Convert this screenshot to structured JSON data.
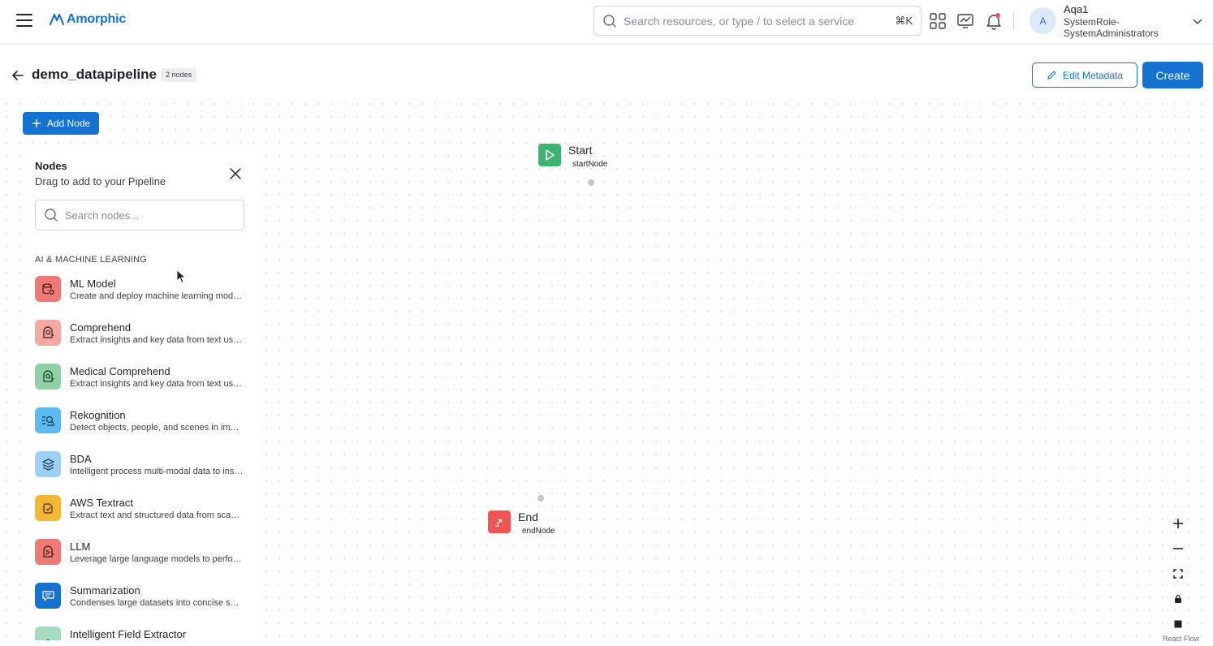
{
  "app": {
    "brand": "Amorphic",
    "brand_color": "#1a73c9",
    "primary_color": "#1572d0"
  },
  "header": {
    "search": {
      "placeholder": "Search resources, or type / to select a service",
      "shortcut": "⌘K"
    },
    "icons": [
      "apps-grid-icon",
      "monitor-chart-icon",
      "bell-icon"
    ],
    "user": {
      "initial": "A",
      "name": "Aqa1",
      "role": "SystemRole-SystemAdministrators"
    }
  },
  "page": {
    "title": "demo_datapipeline",
    "node_count_badge": "2 nodes",
    "edit_metadata_label": "Edit Metadata",
    "create_label": "Create"
  },
  "toolbar": {
    "add_node_label": "Add Node"
  },
  "panel": {
    "title": "Nodes",
    "subtitle": "Drag to add to your Pipeline",
    "search_placeholder": "Search nodes...",
    "section_title": "AI & MACHINE LEARNING",
    "items": [
      {
        "name": "ML Model",
        "description": "Create and deploy machine learning models",
        "icon": "ml-model-icon",
        "color": "#ef7a75"
      },
      {
        "name": "Comprehend",
        "description": "Extract insights and key data from text using NLP",
        "icon": "comprehend-icon",
        "color": "#f4a8a4"
      },
      {
        "name": "Medical Comprehend",
        "description": "Extract insights and key data from text using medical NLP",
        "icon": "medical-comprehend-icon",
        "color": "#8fd1a6"
      },
      {
        "name": "Rekognition",
        "description": "Detect objects, people, and scenes in images",
        "icon": "rekognition-icon",
        "color": "#5bbbf0"
      },
      {
        "name": "BDA",
        "description": "Intelligent process multi-modal data to insights",
        "icon": "bda-layers-icon",
        "color": "#9cd0f5"
      },
      {
        "name": "AWS Textract",
        "description": "Extract text and structured data from scanned documents",
        "icon": "textract-icon",
        "color": "#f5b731"
      },
      {
        "name": "LLM",
        "description": "Leverage large language models to perform tasks",
        "icon": "llm-brain-icon",
        "color": "#ef7a75"
      },
      {
        "name": "Summarization",
        "description": "Condenses large datasets into concise summaries",
        "icon": "summarization-icon",
        "color": "#1572d0"
      },
      {
        "name": "Intelligent Field Extractor",
        "description": "",
        "icon": "field-extractor-icon",
        "color": "#a8dcc0"
      }
    ]
  },
  "flow": {
    "nodes": [
      {
        "name": "Start",
        "id": "startNode",
        "icon": "play-icon",
        "color": "#3cb371"
      },
      {
        "name": "End",
        "id": "endNode",
        "icon": "end-icon",
        "color": "#f05454"
      }
    ]
  },
  "controls": {
    "icons": [
      "zoom-in-icon",
      "zoom-out-icon",
      "fit-view-icon",
      "lock-icon",
      "stop-square-icon"
    ],
    "attribution": "React Flow"
  }
}
